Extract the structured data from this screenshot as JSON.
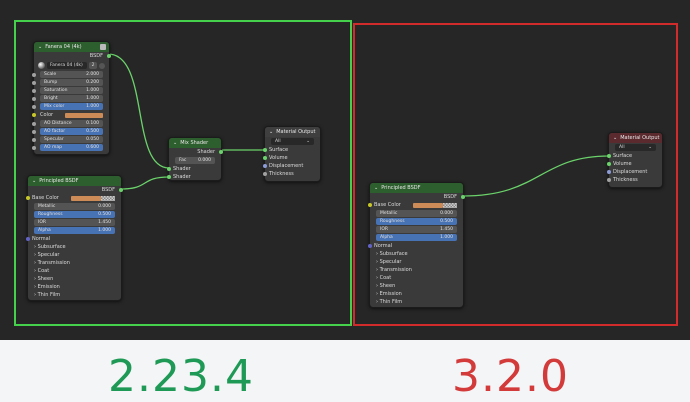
{
  "left": {
    "fanera": {
      "title": "Fanera 04 (4k)",
      "output": "BSDF",
      "group_name": "Fanera 04 (4k)",
      "users": "2",
      "color_label": "Color",
      "inputs": [
        {
          "label": "Scale",
          "value": "2.000"
        },
        {
          "label": "Bump",
          "value": "0.200"
        },
        {
          "label": "Saturation",
          "value": "1.000"
        },
        {
          "label": "Bright",
          "value": "1.000"
        },
        {
          "label": "Mix color",
          "value": "1.000"
        },
        {
          "label": "AO Distance",
          "value": "0.100"
        },
        {
          "label": "AO factor",
          "value": "0.500"
        },
        {
          "label": "Specular",
          "value": "0.050"
        },
        {
          "label": "AO map",
          "value": "0.600"
        }
      ]
    },
    "bsdf": {
      "title": "Principled BSDF",
      "output": "BSDF",
      "base_color": "Base Color",
      "fields": [
        {
          "label": "Metallic",
          "value": "0.000"
        },
        {
          "label": "Roughness",
          "value": "0.500"
        },
        {
          "label": "IOR",
          "value": "1.450"
        },
        {
          "label": "Alpha",
          "value": "1.000"
        }
      ],
      "normal": "Normal",
      "panels": [
        "Subsurface",
        "Specular",
        "Transmission",
        "Coat",
        "Sheen",
        "Emission",
        "Thin Film"
      ]
    },
    "mix": {
      "title": "Mix Shader",
      "output": "Shader",
      "fac_label": "Fac",
      "fac_value": "0.000",
      "in1": "Shader",
      "in2": "Shader"
    },
    "output": {
      "title": "Material Output",
      "target": "All",
      "sockets": [
        "Surface",
        "Volume",
        "Displacement",
        "Thickness"
      ]
    }
  },
  "right": {
    "bsdf": {
      "title": "Principled BSDF",
      "output": "BSDF",
      "base_color": "Base Color",
      "fields": [
        {
          "label": "Metallic",
          "value": "0.000"
        },
        {
          "label": "Roughness",
          "value": "0.500"
        },
        {
          "label": "IOR",
          "value": "1.450"
        },
        {
          "label": "Alpha",
          "value": "1.000"
        }
      ],
      "normal": "Normal",
      "panels": [
        "Subsurface",
        "Specular",
        "Transmission",
        "Coat",
        "Sheen",
        "Emission",
        "Thin Film"
      ]
    },
    "output": {
      "title": "Material Output",
      "target": "All",
      "sockets": [
        "Surface",
        "Volume",
        "Displacement",
        "Thickness"
      ]
    }
  },
  "captions": {
    "left": "2.23.4",
    "right": "3.2.0"
  },
  "colors": {
    "frame_left": "#46d14c",
    "frame_right": "#d22b2b",
    "caption_left": "#1f9a56",
    "caption_right": "#d33a3a",
    "link": "#6bd36b",
    "field_highlight": "#4772b3",
    "base_color_swatch": "#cd8b57"
  }
}
